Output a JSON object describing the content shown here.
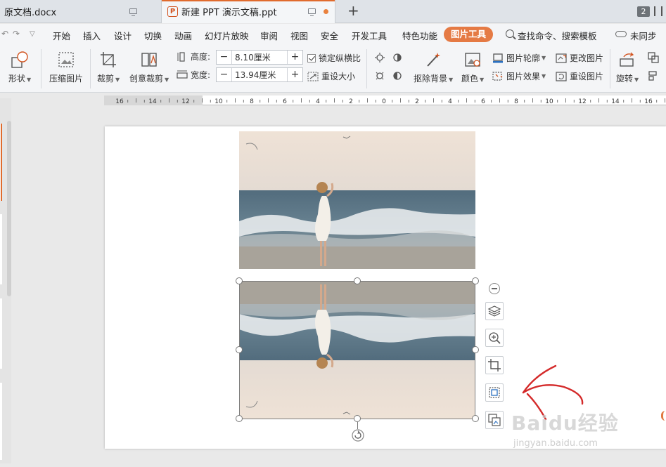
{
  "tabs": [
    {
      "label": "原文档.docx"
    },
    {
      "label": "新建 PPT 演示文稿.ppt"
    }
  ],
  "window": {
    "count": "2"
  },
  "menu": {
    "items": [
      "开始",
      "插入",
      "设计",
      "切换",
      "动画",
      "幻灯片放映",
      "审阅",
      "视图",
      "安全",
      "开发工具",
      "特色功能"
    ],
    "active": "图片工具",
    "search": "查找命令、搜索模板",
    "sync": "未同步"
  },
  "ribbon": {
    "shape": "形状",
    "compress": "压缩图片",
    "crop": "裁剪",
    "creative_crop": "创意裁剪",
    "height_label": "高度:",
    "height_value": "8.10厘米",
    "width_label": "宽度:",
    "width_value": "13.94厘米",
    "lock_ratio": "锁定纵横比",
    "reset_size": "重设大小",
    "remove_bg": "抠除背景",
    "color": "颜色",
    "outline": "图片轮廓",
    "effect": "图片效果",
    "change_pic": "更改图片",
    "reset_pic": "重设图片",
    "rotate": "旋转",
    "minus": "−",
    "plus": "+"
  },
  "ruler": {
    "labels": [
      "16",
      "14",
      "12",
      "10",
      "8",
      "6",
      "4",
      "2",
      "0",
      "2",
      "4",
      "6",
      "8",
      "10",
      "12",
      "14",
      "16"
    ]
  },
  "watermark": {
    "brand": "Baidu经验",
    "url": "jingyan.baidu.com"
  },
  "colors": {
    "accent": "#e57a44",
    "annotation": "#d42a2a"
  },
  "icons": {
    "layers": "layers-icon",
    "zoom": "zoom-in-icon",
    "crop": "crop-icon",
    "fit": "fit-frame-icon",
    "replace": "replace-image-icon",
    "rotate": "rotate-handle-icon"
  }
}
